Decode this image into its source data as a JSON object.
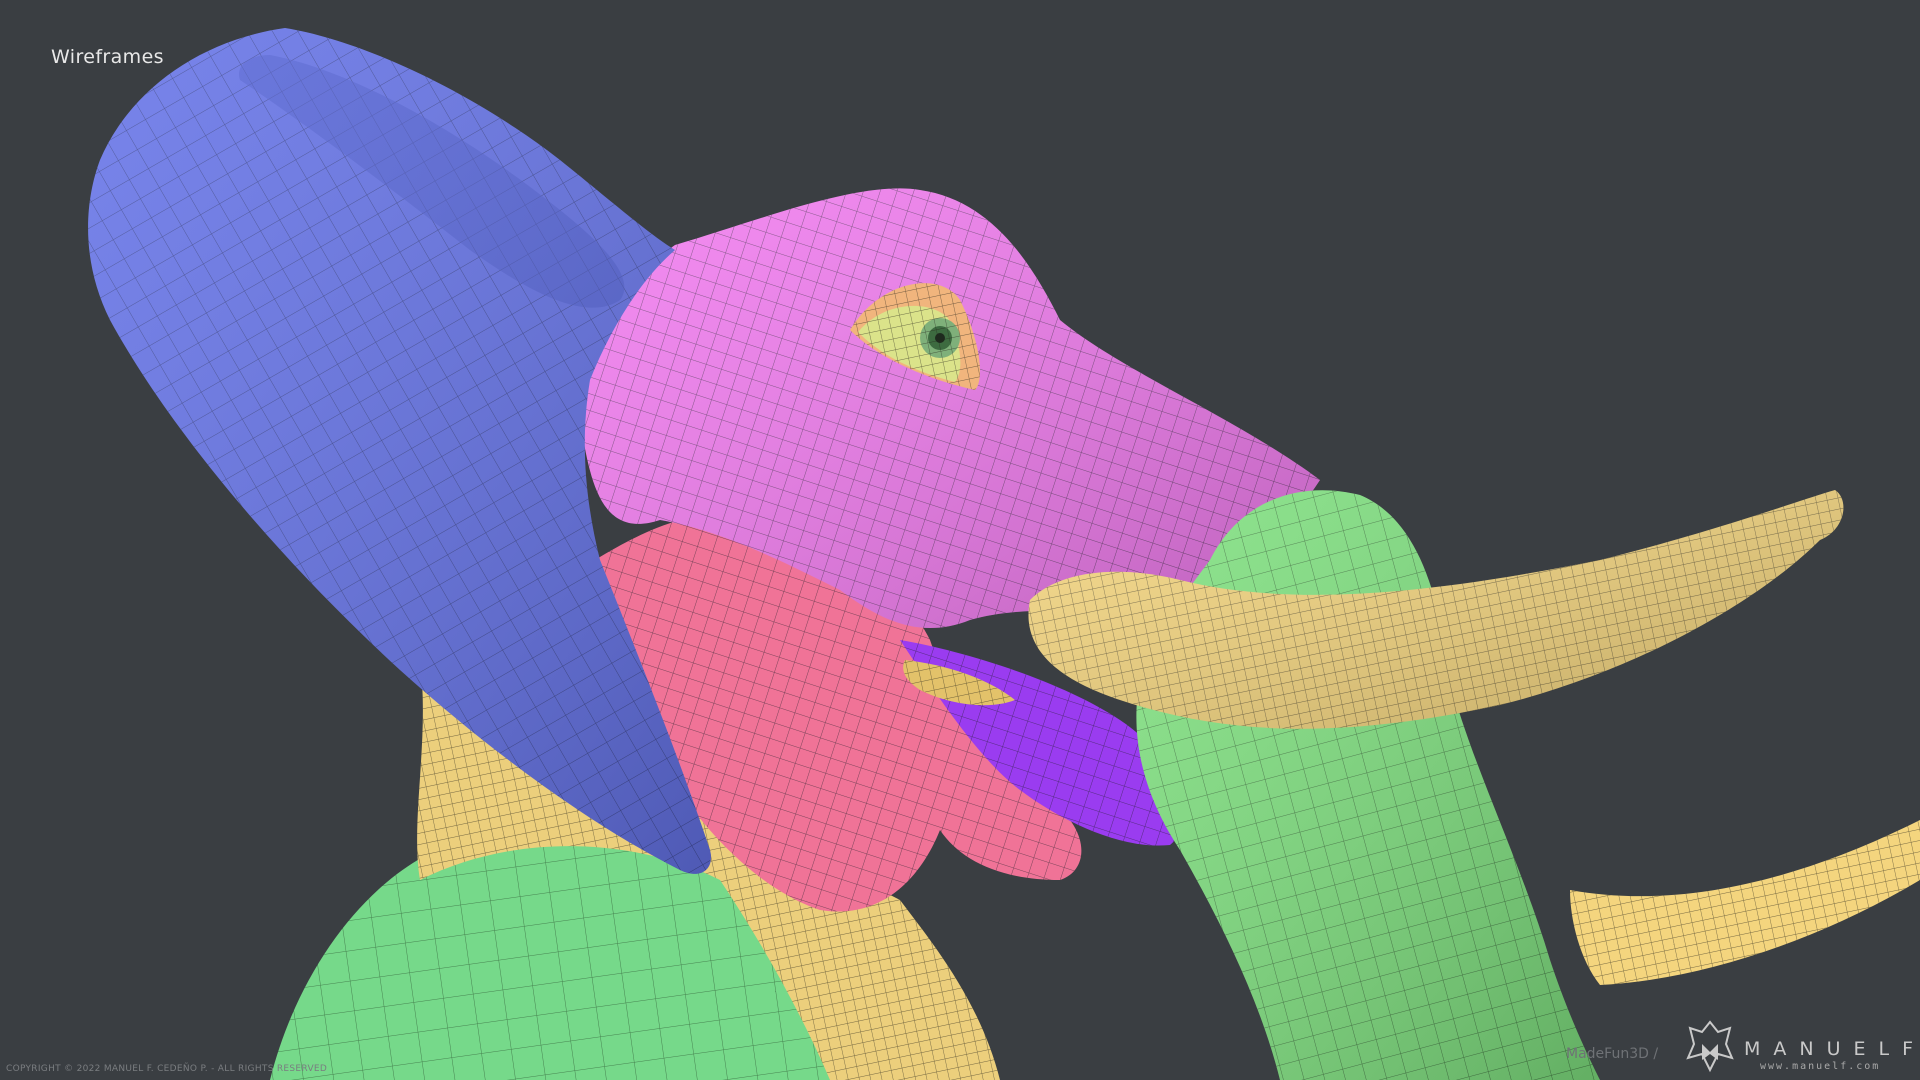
{
  "page": {
    "title": "Wireframes",
    "copyright": "COPYRIGHT © 2022 MANUEL F. CEDEÑO P. - ALL RIGHTS RESERVED",
    "watermark": {
      "made_with": "MadeFun3D /",
      "name": "MANUELF",
      "url": "www.manuelf.com"
    }
  },
  "colors": {
    "background": "#3a3e42",
    "ear": "#6573e8",
    "head": "#f27cf0",
    "cheek": "#f07397",
    "trunk": "#7fe07f",
    "tusk": "#f4d57e",
    "neck": "#eccf7c",
    "body": "#76d98a",
    "mouth": "#9a3cf0",
    "eye_ring": "#f1b57d"
  },
  "image": {
    "subject": "elephant",
    "parts": [
      "ear",
      "head",
      "cheek",
      "trunk",
      "tusk",
      "neck",
      "body",
      "mouth",
      "eye"
    ]
  }
}
